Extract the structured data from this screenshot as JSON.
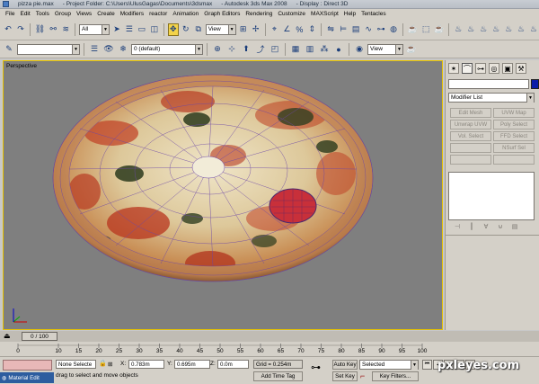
{
  "window": {
    "title_file": "pizza pie.max",
    "title_folder": "- Project Folder: C:\\Users\\UlusGagas\\Documents\\3dsmax",
    "title_app": "- Autodesk 3ds Max 2008",
    "title_display": "- Display : Direct 3D"
  },
  "menu": [
    "File",
    "Edit",
    "Tools",
    "Group",
    "Views",
    "Create",
    "Modifiers",
    "reactor",
    "Animation",
    "Graph Editors",
    "Rendering",
    "Customize",
    "MAXScript",
    "Help",
    "Tentacles"
  ],
  "toolbar1": {
    "selection_filter": "All",
    "ref_coord": "View"
  },
  "toolbar2": {
    "layer": "0 (default)",
    "view_combo": "View"
  },
  "viewport": {
    "label": "Perspective"
  },
  "command_panel": {
    "modifier_list": "Modifier List",
    "buttons": [
      "Edit Mesh",
      "UVW Map",
      "Unwrap UVW",
      "Poly Select",
      "Vol. Select",
      "FFD Select",
      "",
      "NSurf Sel",
      "",
      ""
    ],
    "object_color": "#0b1ca8"
  },
  "time": {
    "slider": "0 / 100",
    "ticks": [
      "0",
      "10",
      "15",
      "20",
      "25",
      "30",
      "35",
      "40",
      "45",
      "50",
      "55",
      "60",
      "65",
      "70",
      "75",
      "80",
      "85",
      "90",
      "95",
      "100"
    ]
  },
  "status": {
    "selection": "None Selecte",
    "x_label": "X:",
    "x_value": "0.783m",
    "y_label": "Y:",
    "y_value": "0.695m",
    "z_label": "Z:",
    "z_value": "0.0m",
    "grid": "Grid = 0.254m",
    "prompt": "drag to select and move objects",
    "add_time_tag": "Add Time Tag",
    "auto_key": "Auto Key",
    "set_key": "Set Key",
    "key_mode": "Selected",
    "key_filters": "Key Filters...",
    "taskbar_item": "Material Edit"
  },
  "watermark": "pxleyes.com"
}
